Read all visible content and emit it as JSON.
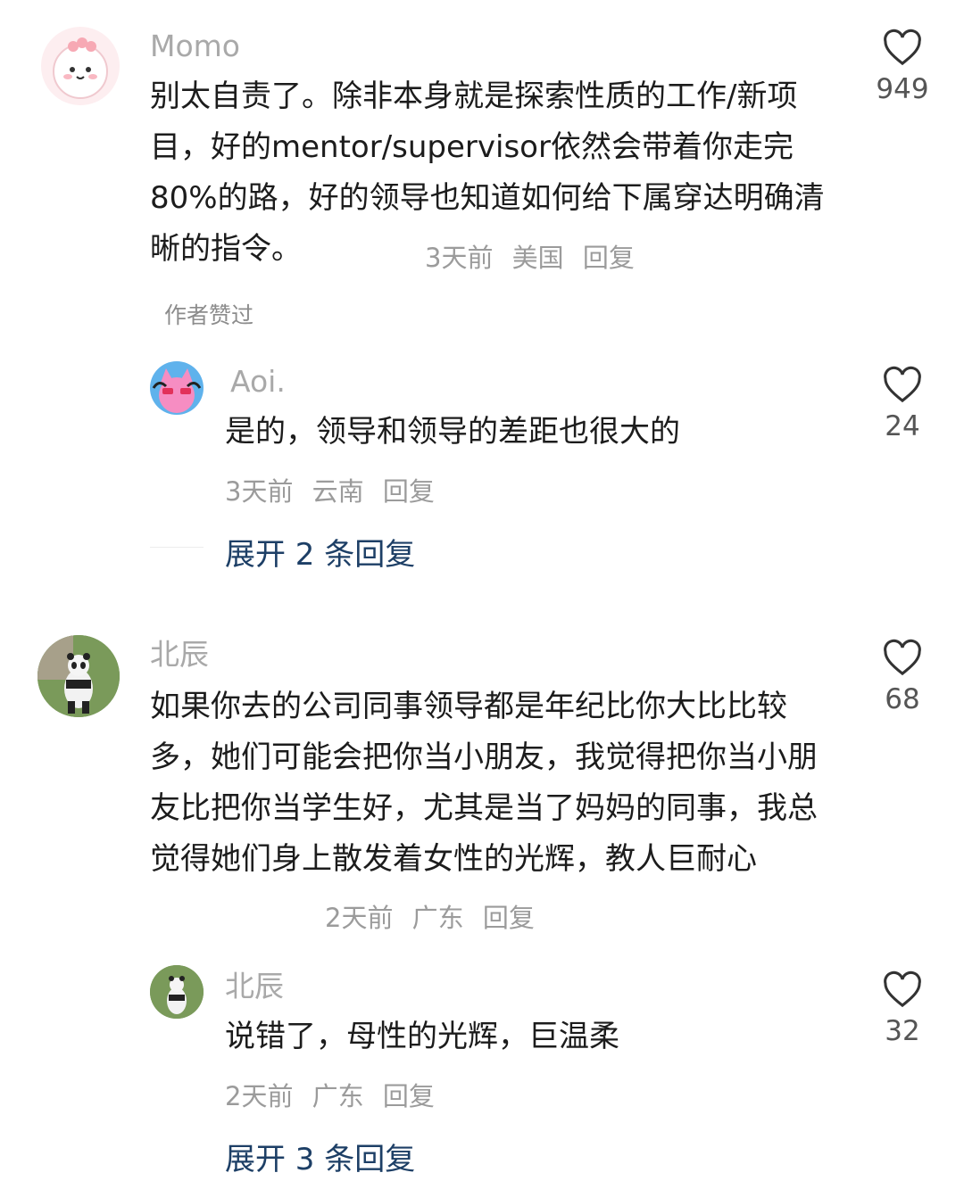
{
  "comments": [
    {
      "user": "Momo",
      "text": "别太自责了。除非本身就是探索性质的工作/新项目，好的mentor/supervisor依然会带着你走完80%的路，好的领导也知道如何给下属穿达明确清晰的指令。",
      "time": "3天前",
      "location": "美国",
      "reply": "回复",
      "likes": "949",
      "author_liked": "作者赞过",
      "sub": {
        "user": "Aoi.",
        "text": "是的，领导和领导的差距也很大的",
        "time": "3天前",
        "location": "云南",
        "reply": "回复",
        "likes": "24"
      },
      "expand": "展开 2 条回复"
    },
    {
      "user": "北辰",
      "text": "如果你去的公司同事领导都是年纪比你大比比较多，她们可能会把你当小朋友，我觉得把你当小朋友比把你当学生好，尤其是当了妈妈的同事，我总觉得她们身上散发着女性的光辉，教人巨耐心",
      "time": "2天前",
      "location": "广东",
      "reply": "回复",
      "likes": "68",
      "sub": {
        "user": "北辰",
        "text": "说错了，母性的光辉，巨温柔",
        "time": "2天前",
        "location": "广东",
        "reply": "回复",
        "likes": "32"
      },
      "expand": "展开 3 条回复"
    }
  ],
  "icons": {
    "like": "heart-outline-icon"
  }
}
